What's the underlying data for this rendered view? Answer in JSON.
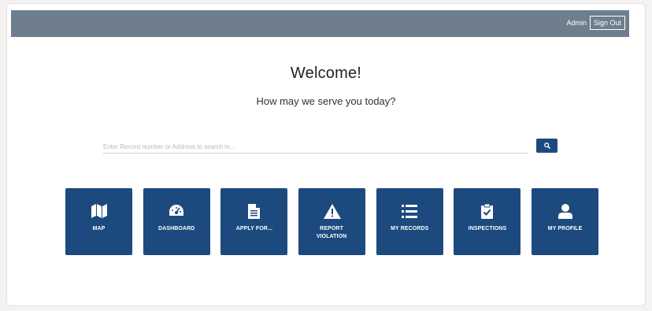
{
  "header": {
    "user_label": "Admin",
    "signout_label": "Sign Out"
  },
  "main": {
    "welcome": "Welcome!",
    "subtitle": "How may we serve you today?"
  },
  "search": {
    "placeholder": "Enter Record number or Address to search in...",
    "button_icon": "search-icon"
  },
  "tiles": [
    {
      "label": "MAP",
      "icon": "map-icon"
    },
    {
      "label": "DASHBOARD",
      "icon": "dashboard-icon"
    },
    {
      "label": "APPLY FOR...",
      "icon": "document-icon"
    },
    {
      "label": "REPORT VIOLATION",
      "icon": "warning-icon"
    },
    {
      "label": "MY RECORDS",
      "icon": "list-icon"
    },
    {
      "label": "INSPECTIONS",
      "icon": "clipboard-check-icon"
    },
    {
      "label": "MY PROFILE",
      "icon": "user-icon"
    }
  ],
  "colors": {
    "topbar": "#6e7e8d",
    "tile": "#1c4a7e",
    "search_button": "#1c4a7e"
  }
}
